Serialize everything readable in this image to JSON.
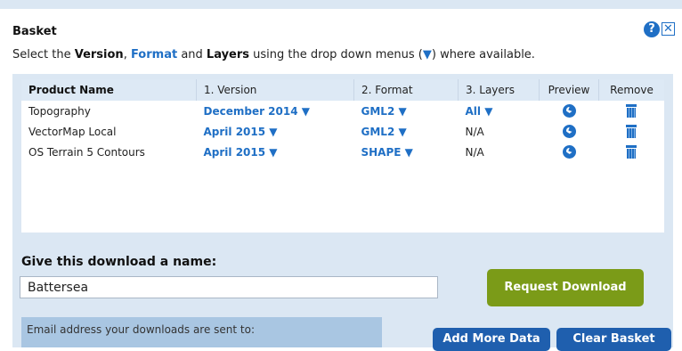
{
  "basket": {
    "title": "Basket",
    "help_glyph": "?",
    "close_glyph": "✕"
  },
  "instructions": {
    "part1": "Select the ",
    "version": "Version",
    "sep1": ", ",
    "format": "Format",
    "sep2": " and ",
    "layers": "Layers",
    "part2": " using the drop down menus (",
    "arrow": "▼",
    "part3": ") where available."
  },
  "table": {
    "headers": [
      "Product Name",
      "1. Version",
      "2. Format",
      "3. Layers",
      "Preview",
      "Remove"
    ],
    "rows": [
      {
        "product": "Topography",
        "version": "December 2014 ▼",
        "format": "GML2 ▼",
        "layers": "All ▼",
        "layers_link": true
      },
      {
        "product": "VectorMap Local",
        "version": "April 2015 ▼",
        "format": "GML2 ▼",
        "layers": "N/A",
        "layers_link": false
      },
      {
        "product": "OS Terrain 5 Contours",
        "version": "April 2015 ▼",
        "format": "SHAPE ▼",
        "layers": "N/A",
        "layers_link": false
      }
    ]
  },
  "download": {
    "name_label": "Give this download a name:",
    "name_value": "Battersea",
    "request_label": "Request Download",
    "email_label": "Email address your downloads are sent to:",
    "add_more_label": "Add More Data",
    "clear_label": "Clear Basket"
  },
  "colors": {
    "accent": "#1f6fc5",
    "request_button": "#7b9b18",
    "panel": "#dbe7f3"
  }
}
